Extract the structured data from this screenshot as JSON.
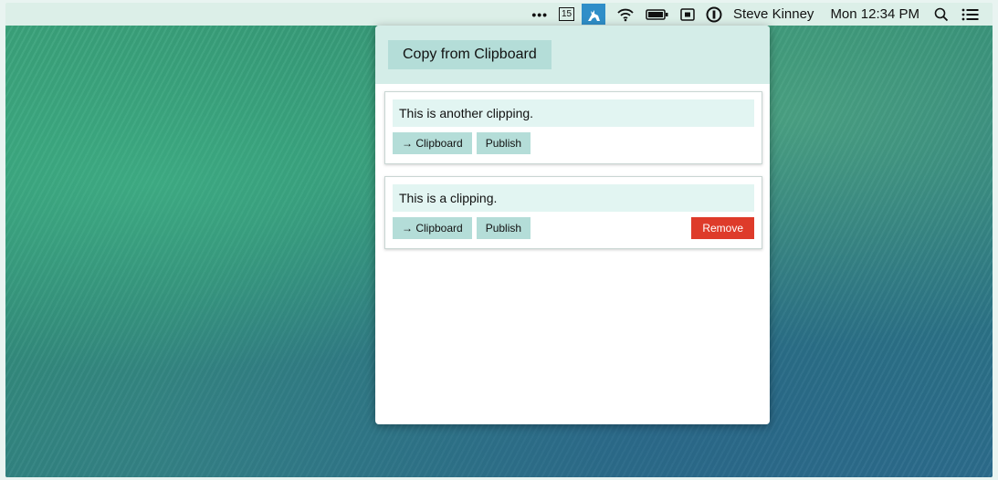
{
  "menubar": {
    "dots": "•••",
    "calendar_day": "15",
    "user_name": "Steve Kinney",
    "clock": "Mon 12:34 PM",
    "icons": [
      "more-icon",
      "calendar-icon",
      "clipmaster-app-icon",
      "wifi-icon",
      "battery-icon",
      "screen-record-icon",
      "password-manager-icon",
      "spotlight-search-icon",
      "notification-center-icon"
    ]
  },
  "popup": {
    "copy_button_label": "Copy from Clipboard",
    "clippings": [
      {
        "text": "This is another clipping.",
        "to_clipboard_label": "→ Clipboard",
        "publish_label": "Publish"
      },
      {
        "text": "This is a clipping.",
        "to_clipboard_label": "→ Clipboard",
        "publish_label": "Publish",
        "remove_label": "Remove"
      }
    ]
  },
  "colors": {
    "header_bg": "#d4ede8",
    "button_bg": "#b4ddd8",
    "clip_text_bg": "#e2f5f2",
    "remove_bg": "#de3b2a",
    "menubar_bg": "#dcefe8"
  }
}
